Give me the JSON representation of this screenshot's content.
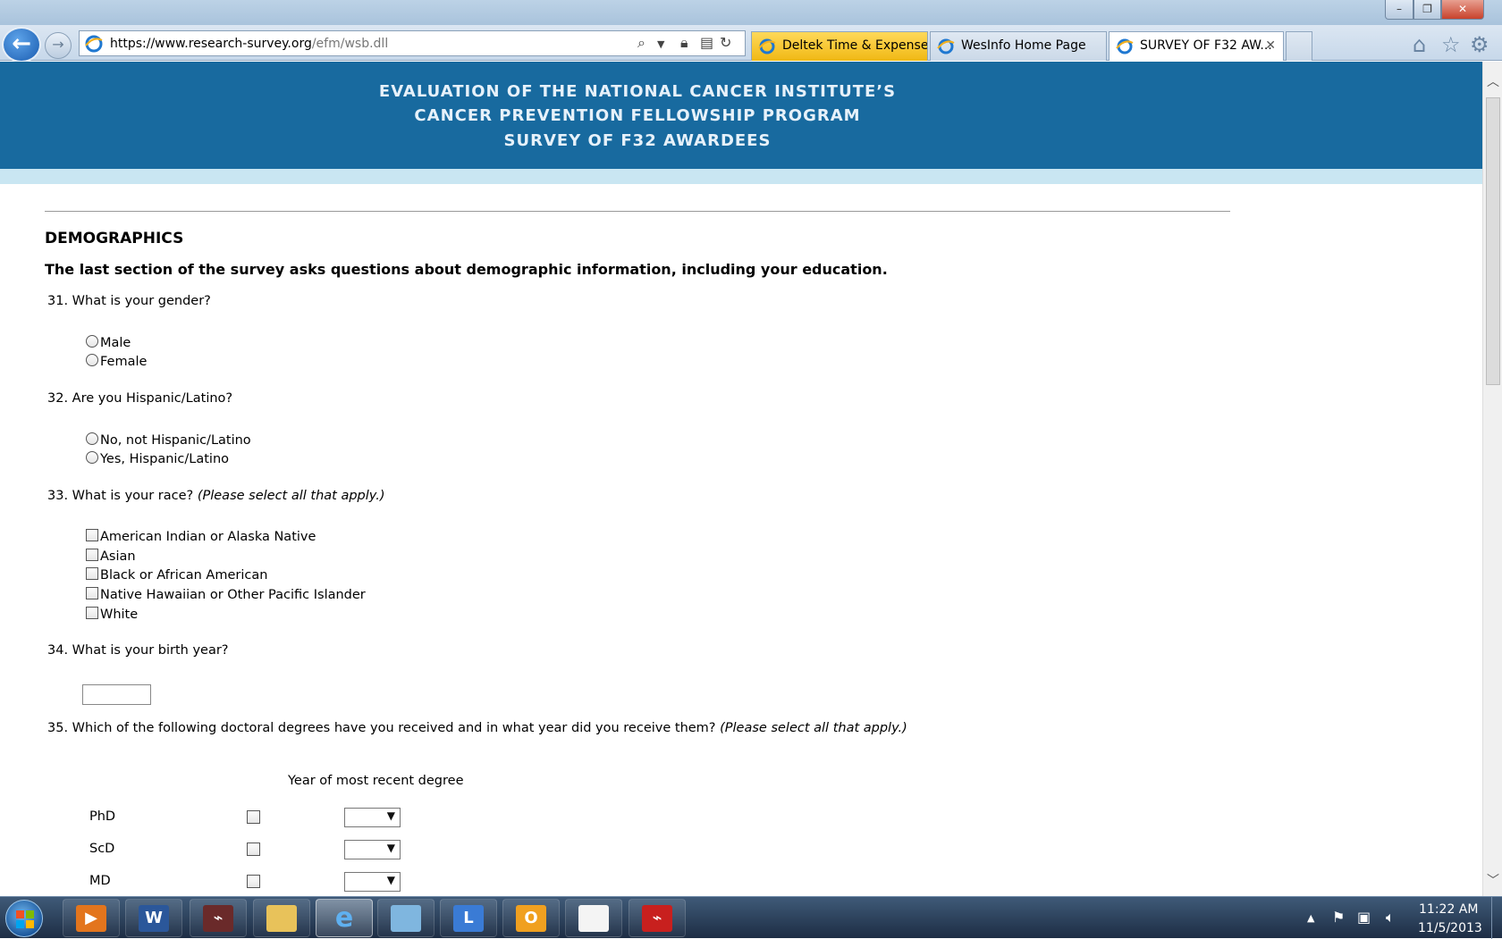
{
  "window": {
    "min_glyph": "–",
    "max_glyph": "❐",
    "close_glyph": "✕"
  },
  "browser": {
    "url_main": "https://www.research-survey.org",
    "url_path": "/efm/wsb.dll",
    "tabs": [
      {
        "label": "Deltek Time & Expense..."
      },
      {
        "label": "WesInfo Home Page"
      },
      {
        "label": "SURVEY OF F32 AW...",
        "close": "✕"
      }
    ]
  },
  "header": {
    "line1": "EVALUATION OF THE NATIONAL CANCER INSTITUTE’S",
    "line2": "CANCER PREVENTION FELLOWSHIP PROGRAM",
    "line3": "SURVEY OF F32 AWARDEES"
  },
  "section": {
    "title": "DEMOGRAPHICS",
    "intro": "The last section of the survey asks questions about demographic information, including your education."
  },
  "questions": {
    "q31": {
      "text": "31. What is your gender?",
      "options": [
        "Male",
        "Female"
      ]
    },
    "q32": {
      "text": "32. Are you Hispanic/Latino?",
      "options": [
        "No, not Hispanic/Latino",
        "Yes, Hispanic/Latino"
      ]
    },
    "q33": {
      "text": "33. What is your race?",
      "note": "(Please select all that apply.)",
      "options": [
        "American Indian or Alaska Native",
        "Asian",
        "Black or African American",
        "Native Hawaiian or Other Pacific Islander",
        "White"
      ]
    },
    "q34": {
      "text": "34. What is your birth year?",
      "value": ""
    },
    "q35": {
      "text": "35. Which of the following doctoral degrees have you received and in what year did you receive them?",
      "note": "(Please select all that apply.)",
      "year_header": "Year of most recent degree",
      "degrees": [
        "PhD",
        "ScD",
        "MD"
      ]
    }
  },
  "taskbar": {
    "time": "11:22 AM",
    "date": "11/5/2013",
    "apps": [
      "windows-media-player",
      "microsoft-word",
      "adobe-acrobat",
      "file-explorer",
      "internet-explorer",
      "notepad",
      "lync",
      "outlook",
      "blank-document",
      "adobe-reader"
    ]
  },
  "colors": {
    "header_bg": "#186a9f",
    "subband": "#c9e6f2",
    "active_tab": "#f0b814"
  }
}
